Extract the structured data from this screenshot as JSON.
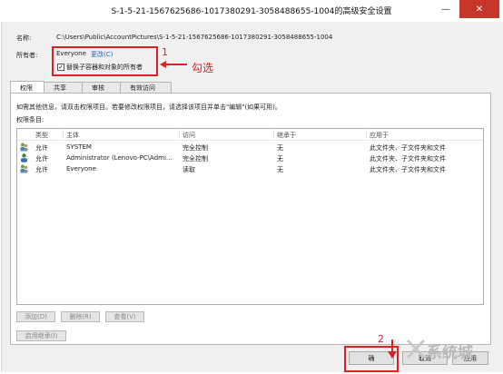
{
  "window": {
    "title": "S-1-5-21-1567625686-1017380291-3058488655-1004的高级安全设置",
    "minimize_glyph": "—",
    "close_glyph": "✕"
  },
  "name_row": {
    "label": "名称:",
    "value": "C:\\Users\\Public\\AccountPictures\\S-1-5-21-1567625686-1017380291-3058488655-1004"
  },
  "owner_row": {
    "label": "所有者:",
    "value": "Everyone",
    "change_link": "更改(C)"
  },
  "replace_owner": {
    "label": "替换子容器和对象的所有者",
    "checked": true,
    "check_glyph": "✓"
  },
  "tabs": [
    {
      "label": "权限",
      "active": true
    },
    {
      "label": "共享",
      "active": false
    },
    {
      "label": "审核",
      "active": false
    },
    {
      "label": "有效访问",
      "active": false
    }
  ],
  "permissions": {
    "instructions": "如需其他信息，请双击权限项目。若要修改权限项目，请选择该项目并单击\"编辑\"(如果可用)。",
    "list_label": "权限条目:",
    "columns": [
      "类型",
      "主体",
      "访问",
      "继承于",
      "应用于"
    ],
    "rows": [
      {
        "type": "允许",
        "principal": "SYSTEM",
        "access": "完全控制",
        "inherited": "无",
        "applies": "此文件夹、子文件夹和文件"
      },
      {
        "type": "允许",
        "principal": "Administrator (Lenovo-PC\\Admi...",
        "access": "完全控制",
        "inherited": "无",
        "applies": "此文件夹、子文件夹和文件"
      },
      {
        "type": "允许",
        "principal": "Everyone",
        "access": "读取",
        "inherited": "无",
        "applies": "此文件夹、子文件夹和文件"
      }
    ]
  },
  "list_buttons": {
    "add": "添加(D)",
    "remove": "删除(R)",
    "view": "查看(V)"
  },
  "enable_inheritance": "启用继承(I)",
  "dialog_buttons": {
    "ok": "确",
    "cancel": "取消",
    "apply": "应用"
  },
  "annotations": {
    "step1": "1",
    "check_hint": "勾选",
    "step2": "2",
    "arrow_glyph": "←"
  },
  "watermark": {
    "text": "系统城"
  },
  "colors": {
    "annotation_red": "#e02020",
    "link_blue": "#1a63c4",
    "close_red": "#c7362b"
  }
}
